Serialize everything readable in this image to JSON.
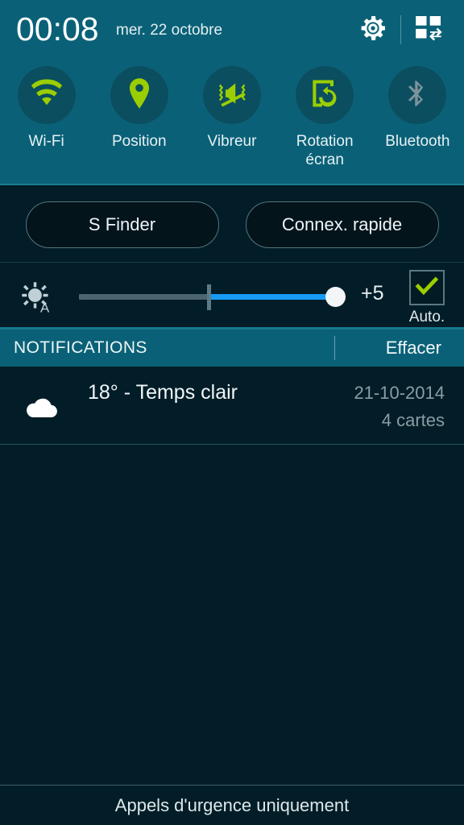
{
  "statusbar": {
    "clock": "00:08",
    "date": "mer. 22 octobre",
    "settings_icon": "gear-icon",
    "multiwindow_icon": "multi-window-icon"
  },
  "quick_toggles": [
    {
      "id": "wifi",
      "label": "Wi-Fi",
      "icon": "wifi-icon",
      "enabled": true,
      "color": "#9ace00"
    },
    {
      "id": "location",
      "label": "Position",
      "icon": "location-pin-icon",
      "enabled": true,
      "color": "#9ace00"
    },
    {
      "id": "vibrate",
      "label": "Vibreur",
      "icon": "vibrate-mute-icon",
      "enabled": true,
      "color": "#9ace00"
    },
    {
      "id": "rotation",
      "label": "Rotation\nécran",
      "icon": "screen-rotation-icon",
      "enabled": true,
      "color": "#9ace00"
    },
    {
      "id": "bluetooth",
      "label": "Bluetooth",
      "icon": "bluetooth-icon",
      "enabled": false,
      "color": "#7e949b"
    }
  ],
  "shortcuts": {
    "s_finder": "S Finder",
    "quick_connect": "Connex. rapide"
  },
  "brightness": {
    "icon": "brightness-auto-icon",
    "value_label": "+5",
    "slider_percent": 98,
    "tick_percent": 48,
    "auto_label": "Auto.",
    "auto_checked": true,
    "fill_color": "#169bf5",
    "check_color": "#9ace00"
  },
  "notifications_header": {
    "title": "NOTIFICATIONS",
    "clear_label": "Effacer"
  },
  "notifications": [
    {
      "icon": "cloud-icon",
      "title": "18° - Temps clair",
      "date": "21-10-2014",
      "subtitle": "4 cartes"
    }
  ],
  "footer": {
    "text": "Appels d'urgence uniquement"
  },
  "theme": {
    "panel_teal": "#0a6177",
    "dark_bg": "#021d27",
    "accent_green": "#9ace00",
    "accent_blue": "#169bf5"
  }
}
